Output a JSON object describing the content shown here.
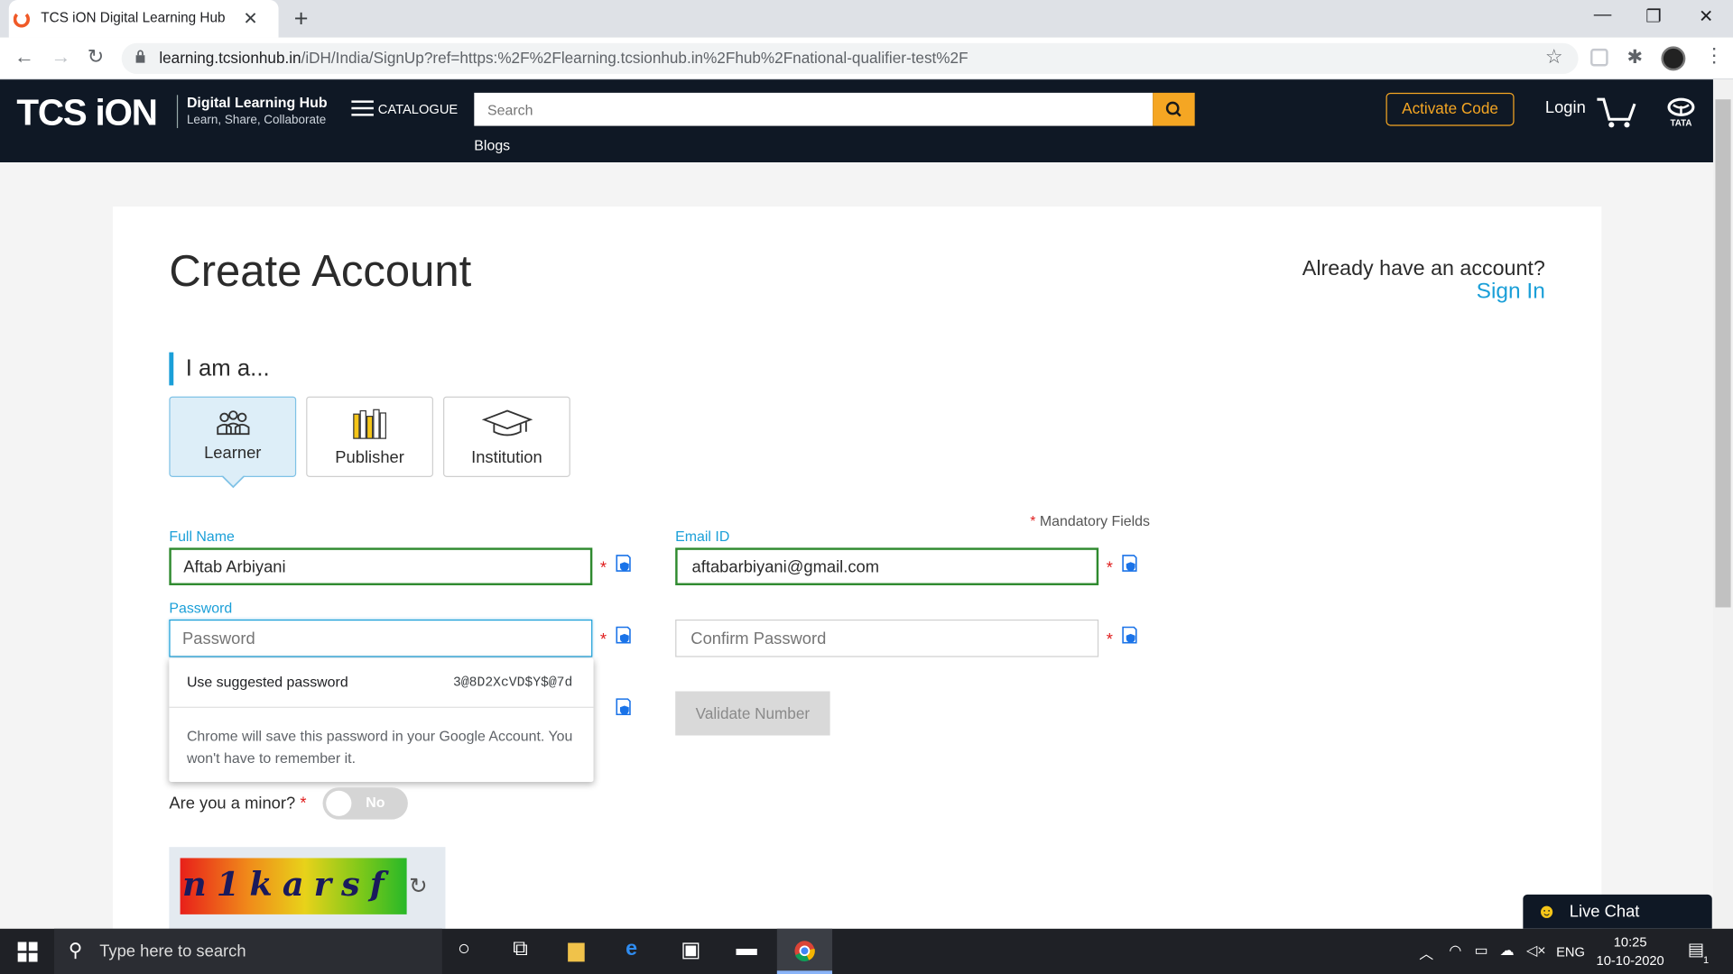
{
  "browser": {
    "tab_title": "TCS iON Digital Learning Hub",
    "tab_close": "✕",
    "new_tab": "+",
    "url_host": "learning.tcsionhub.in",
    "url_path": "/iDH/India/SignUp?ref=https:%2F%2Flearning.tcsionhub.in%2Fhub%2Fnational-qualifier-test%2F",
    "minimize": "—",
    "restore": "❐",
    "close": "✕"
  },
  "header": {
    "logo": "TCS iON",
    "logo_title": "Digital Learning Hub",
    "logo_subtitle": "Learn, Share, Collaborate",
    "catalogue": "CATALOGUE",
    "search_placeholder": "Search",
    "blogs": "Blogs",
    "activate_code": "Activate Code",
    "login": "Login",
    "brand_colors": {
      "accent": "#f5a623",
      "header_bg": "#0f1825",
      "link": "#1a9fd8"
    }
  },
  "page": {
    "title": "Create Account",
    "already_account": "Already have an account?",
    "sign_in": "Sign In",
    "iam": "I am a...",
    "roles": [
      {
        "label": "Learner",
        "selected": true
      },
      {
        "label": "Publisher",
        "selected": false
      },
      {
        "label": "Institution",
        "selected": false
      }
    ],
    "mandatory_star": "*",
    "mandatory_label": "Mandatory Fields",
    "full_name_label": "Full Name",
    "full_name_value": "Aftab Arbiyani",
    "email_label": "Email ID",
    "email_value": "aftabarbiyani@gmail.com",
    "password_label": "Password",
    "password_placeholder": "Password",
    "confirm_placeholder": "Confirm Password",
    "required_star": "*",
    "validate_number": "Validate Number",
    "minor_question": "Are you a minor?",
    "minor_toggle": "No",
    "captcha_text": "n1karsf"
  },
  "autofill": {
    "use_suggested": "Use suggested password",
    "suggested_password": "3@8D2XcVD$Y$@7d",
    "note": "Chrome will save this password in your Google Account. You won't have to remember it."
  },
  "livechat": {
    "label": "Live Chat"
  },
  "taskbar": {
    "search_placeholder": "Type here to search",
    "lang": "ENG",
    "time": "10:25",
    "date": "10-10-2020",
    "notification_count": "1"
  }
}
